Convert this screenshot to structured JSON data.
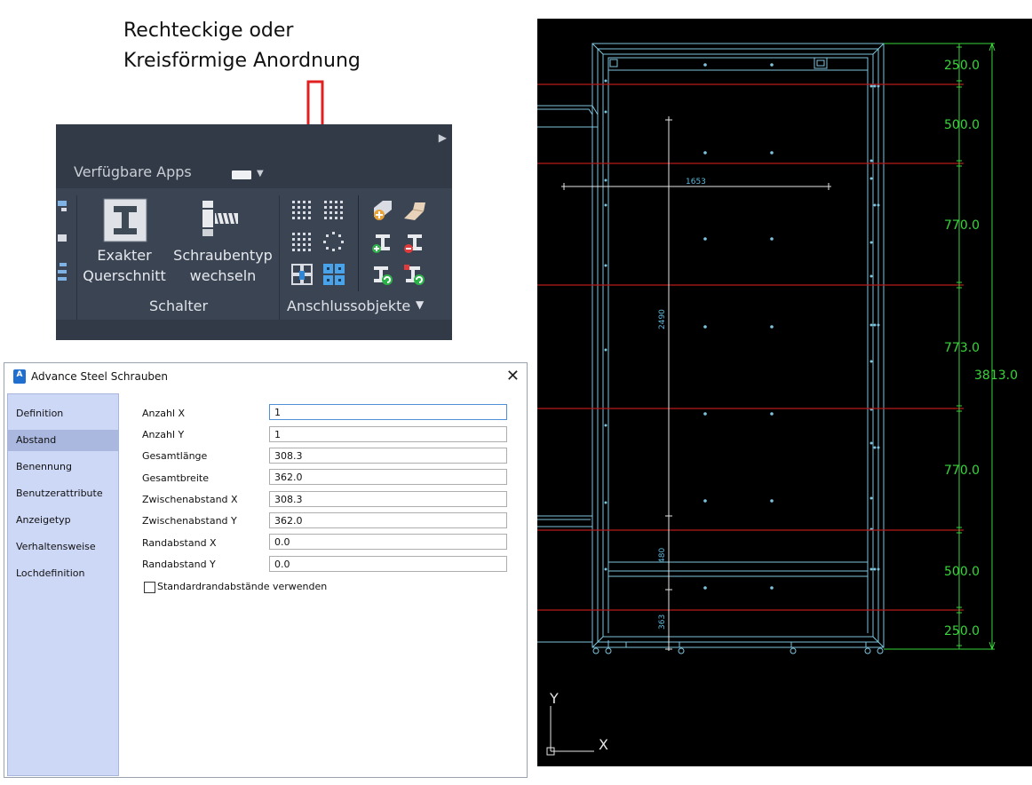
{
  "annotation": {
    "line1": "Rechteckige oder",
    "line2": "Kreisförmige Anordnung"
  },
  "ribbon": {
    "apps_label": "Verfügbare Apps",
    "button_exact": {
      "line1": "Exakter",
      "line2": "Querschnitt"
    },
    "button_bolttype": {
      "line1": "Schraubentyp",
      "line2": "wechseln"
    },
    "group_schalter": "Schalter",
    "group_anschluss": "Anschlussobjekte",
    "colors": {
      "background": "#3b4453",
      "accent": "#e02020"
    }
  },
  "dialog": {
    "app_icon": "A",
    "title": "Advance Steel  Schrauben",
    "sidebar": [
      "Definition",
      "Abstand",
      "Benennung",
      "Benutzerattribute",
      "Anzeigetyp",
      "Verhaltensweise",
      "Lochdefinition"
    ],
    "active_item": "Abstand",
    "fields": [
      {
        "label": "Anzahl X",
        "value": "1"
      },
      {
        "label": "Anzahl Y",
        "value": "1"
      },
      {
        "label": "Gesamtlänge",
        "value": "308.3"
      },
      {
        "label": "Gesamtbreite",
        "value": "362.0"
      },
      {
        "label": "Zwischenabstand X",
        "value": "308.3"
      },
      {
        "label": "Zwischenabstand Y",
        "value": "362.0"
      },
      {
        "label": "Randabstand X",
        "value": "0.0"
      },
      {
        "label": "Randabstand Y",
        "value": "0.0"
      }
    ],
    "checkbox_label": "Standardrandabstände verwenden",
    "checkbox_checked": false
  },
  "cad": {
    "right_dims": [
      "250.0",
      "500.0",
      "770.0",
      "773.0",
      "770.0",
      "500.0",
      "250.0"
    ],
    "total_dim": "3813.0",
    "width_dim": "1653",
    "height_dim": "2490",
    "dim_480": "480",
    "dim_363": "363",
    "ucs_x": "X",
    "ucs_y": "Y",
    "colors": {
      "background": "#000000",
      "frame": "#7fc4dc",
      "grid_line": "#b81a1a",
      "dim": "#39d53b"
    }
  }
}
